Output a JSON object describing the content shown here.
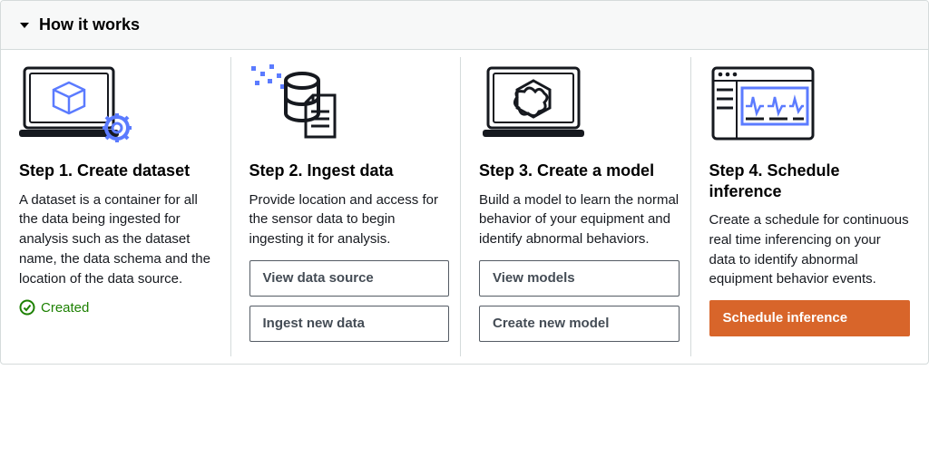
{
  "header": {
    "title": "How it works"
  },
  "steps": [
    {
      "title": "Step 1. Create dataset",
      "description": "A dataset is a container for all the data being ingested for analysis such as the dataset name, the data schema and the location of the data source.",
      "status": "Created"
    },
    {
      "title": "Step 2. Ingest data",
      "description": "Provide location and access for the sensor data to begin ingesting it for analysis.",
      "buttons": {
        "view": "View data source",
        "ingest": "Ingest new data"
      }
    },
    {
      "title": "Step 3. Create a model",
      "description": "Build a model to learn the normal behavior of your equipment and identify abnormal behaviors.",
      "buttons": {
        "view": "View models",
        "create": "Create new model"
      }
    },
    {
      "title": "Step 4. Schedule inference",
      "description": "Create a schedule for continuous real time inferencing on your data to identify abnormal equipment behavior events.",
      "buttons": {
        "schedule": "Schedule inference"
      }
    }
  ]
}
